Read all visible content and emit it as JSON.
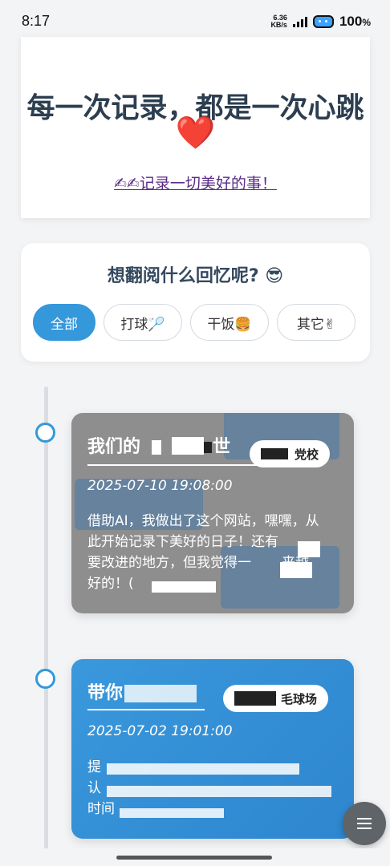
{
  "status_bar": {
    "time": "8:17",
    "net_speed": "6.36",
    "net_unit": "KB/s",
    "battery": "100",
    "battery_suffix": "%"
  },
  "hero": {
    "title": "每一次记录，都是一次心跳",
    "heart": "❤️",
    "link_emoji": "✍✍",
    "link_text": "记录一切美好的事！"
  },
  "filter": {
    "question": "想翻阅什么回忆呢? 😎",
    "chips": [
      {
        "label": "全部",
        "active": true
      },
      {
        "label": "打球🏸",
        "active": false
      },
      {
        "label": "干饭🍔",
        "active": false
      },
      {
        "label": "其它✌",
        "active": false
      }
    ]
  },
  "timeline": [
    {
      "title_start": "我们的",
      "title_end": "世",
      "tag": "党校",
      "date": "2025-07-10 19:08:00",
      "text_1": "借助AI，我做出了这个网站，嘿嘿，从",
      "text_2": "此开始记录下美好的日子！还有",
      "text_3": "要改进的地方，但我觉得一",
      "text_3b": "来越",
      "text_4": "好的！("
    },
    {
      "title_start": "带你",
      "title_end": "",
      "tag": "毛球场",
      "date": "2025-07-02 19:01:00",
      "text_1": "提",
      "text_2": "认",
      "text_3": "时间"
    }
  ],
  "fab_icon": "menu-icon"
}
